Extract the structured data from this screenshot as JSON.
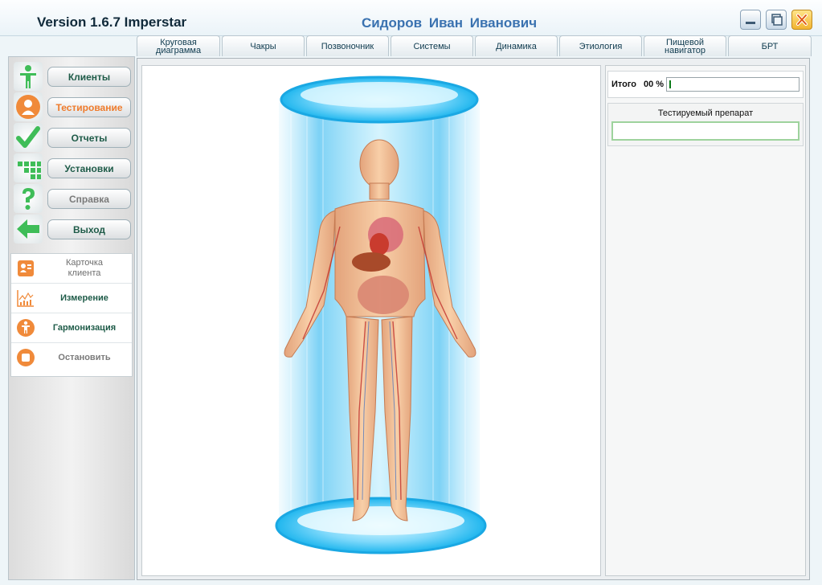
{
  "window": {
    "title": "Version 1.6.7 Imperstar",
    "user_name": "Сидоров  Иван  Иванович",
    "controls": [
      "minimize-icon",
      "maximize-icon",
      "close-icon"
    ]
  },
  "tabs": [
    {
      "label": "Круговая\nдиаграмма"
    },
    {
      "label": "Чакры"
    },
    {
      "label": "Позвоночник"
    },
    {
      "label": "Системы"
    },
    {
      "label": "Динамика"
    },
    {
      "label": "Этиология"
    },
    {
      "label": "Пищевой\nнавигатор"
    },
    {
      "label": "БРТ"
    }
  ],
  "nav": {
    "items": [
      {
        "label": "Клиенты",
        "icon": "person-icon"
      },
      {
        "label": "Тестирование",
        "icon": "user-icon"
      },
      {
        "label": "Отчеты",
        "icon": "checkmark-icon"
      },
      {
        "label": "Установки",
        "icon": "grid-icon"
      },
      {
        "label": "Справка",
        "icon": "question-icon"
      },
      {
        "label": "Выход",
        "icon": "exit-arrow-icon"
      }
    ],
    "active_label": "Тестирование"
  },
  "actions": [
    {
      "label": "Карточка\nклиента",
      "icon": "client-card-icon"
    },
    {
      "label": "Измерение",
      "icon": "measure-chart-icon"
    },
    {
      "label": "Гармонизация",
      "icon": "harmonize-icon"
    },
    {
      "label": "Остановить",
      "icon": "stop-icon"
    }
  ],
  "results": {
    "total_label": "Итого",
    "total_value": "00 %",
    "progress_fraction": 0.0
  },
  "drug": {
    "label": "Тестируемый препарат",
    "value": ""
  },
  "colors": {
    "accent_orange": "#ef7b2c",
    "nav_text_green": "#1e5b48",
    "title_blue": "#3a72b0",
    "hologram_cyan": "#39c7f2"
  }
}
